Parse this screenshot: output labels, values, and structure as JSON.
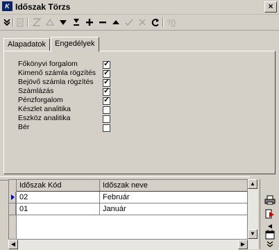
{
  "window": {
    "title": "Időszak Törzs",
    "app_icon_text": "K",
    "close_glyph": "×"
  },
  "toolbar": {
    "icons": [
      "chevron-down-icon",
      "clipboard-icon",
      "filter-icon",
      "sort-asc-icon",
      "arrow-down-icon",
      "last-icon",
      "plus-icon",
      "minus-icon",
      "arrow-up-icon",
      "check-icon",
      "cancel-icon",
      "refresh-icon",
      "help-icon"
    ]
  },
  "tabs": [
    {
      "label": "Alapadatok",
      "active": false
    },
    {
      "label": "Engedélyek",
      "active": true
    }
  ],
  "permissions": [
    {
      "label": "Főkönyvi forgalom",
      "checked": true
    },
    {
      "label": "Kimenő számla rögzítés",
      "checked": true
    },
    {
      "label": "Bejövő számla rögzítés",
      "checked": true
    },
    {
      "label": "Számlázás",
      "checked": true
    },
    {
      "label": "Pénzforgalom",
      "checked": true
    },
    {
      "label": "Készlet analitika",
      "checked": false
    },
    {
      "label": "Eszköz analitika",
      "checked": false
    },
    {
      "label": "Bér",
      "checked": false
    }
  ],
  "grid": {
    "columns": [
      "Időszak Kód",
      "Időszak neve"
    ],
    "rows": [
      {
        "code": "02",
        "name": "Február",
        "current": true
      },
      {
        "code": "01",
        "name": "Január",
        "current": false
      }
    ]
  },
  "side_tools": [
    "printer-icon",
    "export-icon",
    "nav-arrow-icon",
    "calendar-icon",
    "expand-icon"
  ],
  "colors": {
    "window_bg": "#d4d0c8",
    "title_icon": "#0a246a",
    "row_indicator": "#0000c0",
    "export_icon": "#d00000"
  }
}
